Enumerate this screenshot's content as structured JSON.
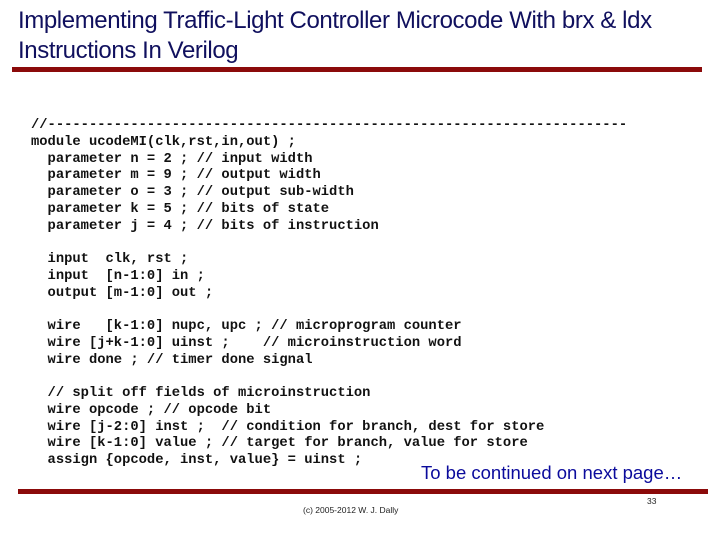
{
  "slide": {
    "title_lines": [
      "Implementing Traffic-Light Controller Microcode With brx & ldx",
      "Instructions In Verilog"
    ],
    "code_lines": [
      "//----------------------------------------------------------------------",
      "module ucodeMI(clk,rst,in,out) ;",
      "  parameter n = 2 ; // input width",
      "  parameter m = 9 ; // output width",
      "  parameter o = 3 ; // output sub-width",
      "  parameter k = 5 ; // bits of state",
      "  parameter j = 4 ; // bits of instruction",
      "",
      "  input  clk, rst ;",
      "  input  [n-1:0] in ;",
      "  output [m-1:0] out ;",
      "",
      "  wire   [k-1:0] nupc, upc ; // microprogram counter",
      "  wire [j+k-1:0] uinst ;    // microinstruction word",
      "  wire done ; // timer done signal",
      "",
      "  // split off fields of microinstruction",
      "  wire opcode ; // opcode bit",
      "  wire [j-2:0] inst ;  // condition for branch, dest for store",
      "  wire [k-1:0] value ; // target for branch, value for store",
      "  assign {opcode, inst, value} = uinst ;"
    ],
    "continued_note": "To be continued on next page…",
    "footer": {
      "copyright": "(c) 2005-2012 W. J. Dally",
      "page_number": "33"
    },
    "colors": {
      "title": "#10105e",
      "rule": "#8b0a0a",
      "continued_note": "#0b0b9c",
      "code": "#111111"
    }
  }
}
